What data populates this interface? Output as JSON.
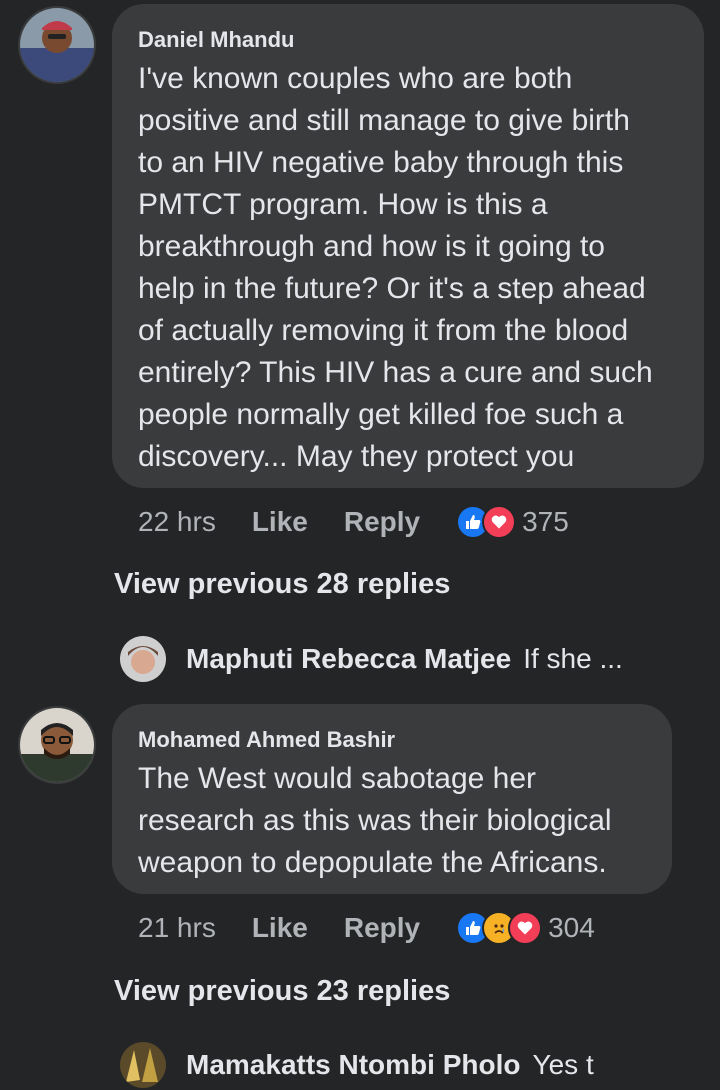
{
  "comments": [
    {
      "author": "Daniel Mhandu",
      "lines": [
        "I've known couples who are both",
        "positive and still manage to give birth",
        "to an HIV negative baby through this",
        "PMTCT program. How is this a",
        "breakthrough and how is it going to",
        "help in the future? Or it's a step ahead",
        "of actually removing it from the blood",
        "entirely? This HIV has a cure and such",
        "people normally get killed foe such a",
        "discovery... May they protect you"
      ],
      "time": "22 hrs",
      "like_label": "Like",
      "reply_label": "Reply",
      "reactions": [
        "like-icon",
        "love-icon"
      ],
      "reaction_count": "375",
      "view_previous": "View previous 28 replies",
      "reply_preview": {
        "name": "Maphuti Rebecca Matjee",
        "snippet": "If she ..."
      }
    },
    {
      "author": "Mohamed Ahmed Bashir",
      "lines": [
        "The West would sabotage her",
        "research as this was their biological",
        "weapon to depopulate the Africans."
      ],
      "time": "21 hrs",
      "like_label": "Like",
      "reply_label": "Reply",
      "reactions": [
        "like-icon",
        "sad-icon",
        "love-icon"
      ],
      "reaction_count": "304",
      "view_previous": "View previous 23 replies",
      "reply_preview": {
        "name": "Mamakatts Ntombi Pholo",
        "snippet": "Yes t"
      }
    }
  ],
  "colors": {
    "background": "#242526",
    "bubble": "#3a3b3c",
    "text": "#e4e6eb",
    "muted": "#b0b3b8",
    "like_blue": "#1877f2",
    "love_red": "#f33e58",
    "sad_yellow": "#f7b125"
  }
}
